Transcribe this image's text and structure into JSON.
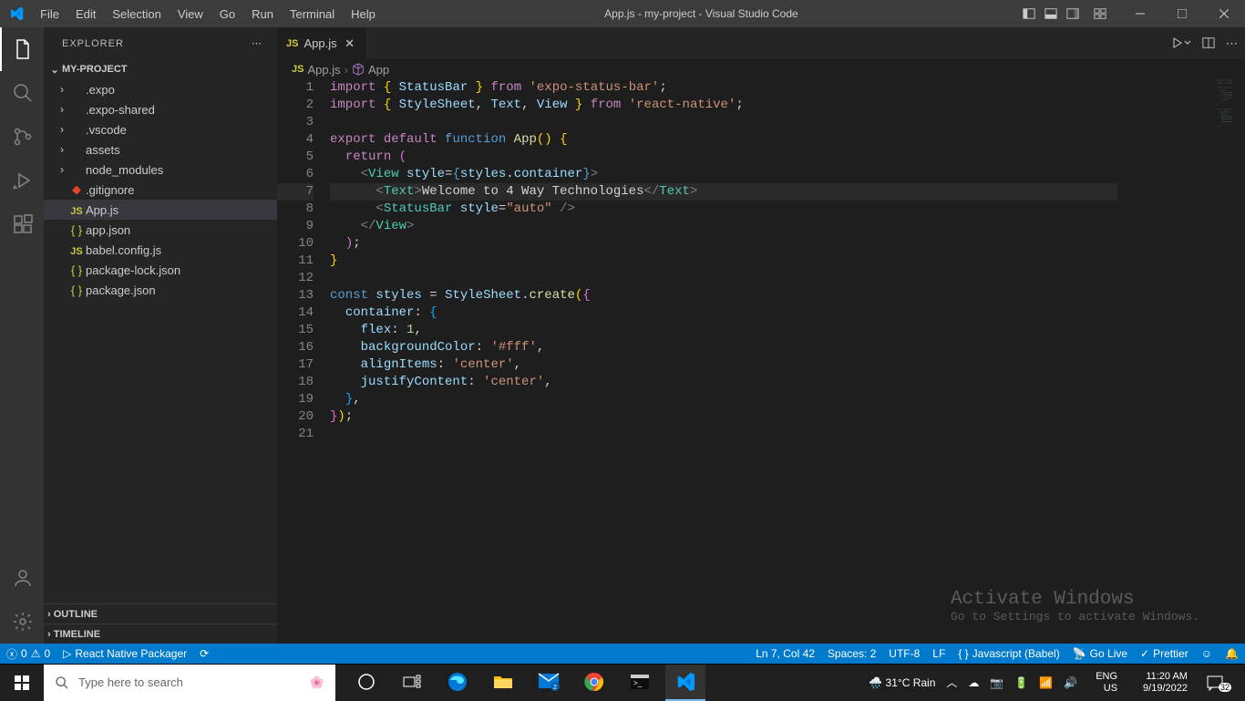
{
  "menu": [
    "File",
    "Edit",
    "Selection",
    "View",
    "Go",
    "Run",
    "Terminal",
    "Help"
  ],
  "window_title": "App.js - my-project - Visual Studio Code",
  "sidebar": {
    "title": "EXPLORER",
    "project": "MY-PROJECT",
    "folders": [
      ".expo",
      ".expo-shared",
      ".vscode",
      "assets",
      "node_modules"
    ],
    "files": [
      {
        "name": ".gitignore",
        "icon": "git"
      },
      {
        "name": "App.js",
        "icon": "js",
        "selected": true
      },
      {
        "name": "app.json",
        "icon": "json"
      },
      {
        "name": "babel.config.js",
        "icon": "js"
      },
      {
        "name": "package-lock.json",
        "icon": "json"
      },
      {
        "name": "package.json",
        "icon": "json"
      }
    ],
    "collapsed": [
      "OUTLINE",
      "TIMELINE"
    ]
  },
  "tab": {
    "name": "App.js"
  },
  "breadcrumb": {
    "file": "App.js",
    "symbol": "App"
  },
  "code_html": "<span class='tok-kw'>import</span> <span class='tok-brace'>{</span> <span class='tok-var'>StatusBar</span> <span class='tok-brace'>}</span> <span class='tok-kw'>from</span> <span class='tok-str'>'expo-status-bar'</span><span class='tok-punc'>;</span>\n<span class='tok-kw'>import</span> <span class='tok-brace'>{</span> <span class='tok-var'>StyleSheet</span><span class='tok-punc'>,</span> <span class='tok-var'>Text</span><span class='tok-punc'>,</span> <span class='tok-var'>View</span> <span class='tok-brace'>}</span> <span class='tok-kw'>from</span> <span class='tok-str'>'react-native'</span><span class='tok-punc'>;</span>\n\n<span class='tok-kw'>export</span> <span class='tok-kw'>default</span> <span class='tok-const'>function</span> <span class='tok-fn'>App</span><span class='tok-brace'>()</span> <span class='tok-brace'>{</span>\n  <span class='tok-kw'>return</span> <span class='tok-brace2'>(</span>\n    <span class='tok-tag'>&lt;</span><span class='tok-tagname'>View</span> <span class='tok-attr'>style</span><span class='tok-punc'>=</span><span class='tok-const'>{</span><span class='tok-var'>styles</span><span class='tok-punc'>.</span><span class='tok-var'>container</span><span class='tok-const'>}</span><span class='tok-tag'>&gt;</span>\n      <span class='tok-tag'>&lt;</span><span class='tok-tagname'>Text</span><span class='tok-tag'>&gt;</span><span class='tok-default'>Welcome to 4 Way Technologies</span><span class='tok-tag'>&lt;/</span><span class='tok-tagname'>Text</span><span class='tok-tag'>&gt;</span>\n      <span class='tok-tag'>&lt;</span><span class='tok-tagname'>StatusBar</span> <span class='tok-attr'>style</span><span class='tok-punc'>=</span><span class='tok-str'>\"auto\"</span> <span class='tok-tag'>/&gt;</span>\n    <span class='tok-tag'>&lt;/</span><span class='tok-tagname'>View</span><span class='tok-tag'>&gt;</span>\n  <span class='tok-brace2'>)</span><span class='tok-punc'>;</span>\n<span class='tok-brace'>}</span>\n\n<span class='tok-const'>const</span> <span class='tok-var'>styles</span> <span class='tok-punc'>=</span> <span class='tok-var'>StyleSheet</span><span class='tok-punc'>.</span><span class='tok-fn'>create</span><span class='tok-brace'>(</span><span class='tok-brace2'>{</span>\n  <span class='tok-var'>container</span><span class='tok-punc'>:</span> <span class='tok-brace3'>{</span>\n    <span class='tok-var'>flex</span><span class='tok-punc'>:</span> <span class='tok-num'>1</span><span class='tok-punc'>,</span>\n    <span class='tok-var'>backgroundColor</span><span class='tok-punc'>:</span> <span class='tok-str'>'#fff'</span><span class='tok-punc'>,</span>\n    <span class='tok-var'>alignItems</span><span class='tok-punc'>:</span> <span class='tok-str'>'center'</span><span class='tok-punc'>,</span>\n    <span class='tok-var'>justifyContent</span><span class='tok-punc'>:</span> <span class='tok-str'>'center'</span><span class='tok-punc'>,</span>\n  <span class='tok-brace3'>}</span><span class='tok-punc'>,</span>\n<span class='tok-brace2'>}</span><span class='tok-brace'>)</span><span class='tok-punc'>;</span>\n",
  "line_count": 21,
  "highlight_line": 7,
  "watermark": {
    "title": "Activate Windows",
    "sub": "Go to Settings to activate Windows."
  },
  "status": {
    "errors": "0",
    "warnings": "0",
    "packager": "React Native Packager",
    "position": "Ln 7, Col 42",
    "spaces": "Spaces: 2",
    "encoding": "UTF-8",
    "eol": "LF",
    "lang": "Javascript (Babel)",
    "golive": "Go Live",
    "prettier": "Prettier"
  },
  "taskbar": {
    "search_placeholder": "Type here to search",
    "weather": "31°C  Rain",
    "lang1": "ENG",
    "lang2": "US",
    "time": "11:20 AM",
    "date": "9/19/2022",
    "notif_count": "32"
  }
}
